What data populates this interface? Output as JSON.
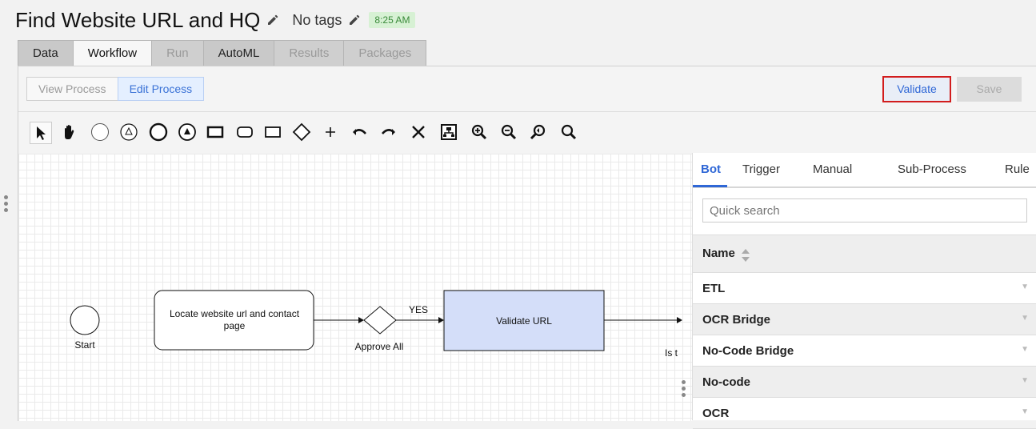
{
  "header": {
    "title": "Find Website URL and HQ",
    "tags": "No tags",
    "time": "8:25 AM"
  },
  "tabs": [
    {
      "label": "Data",
      "state": "normal"
    },
    {
      "label": "Workflow",
      "state": "active"
    },
    {
      "label": "Run",
      "state": "disabled"
    },
    {
      "label": "AutoML",
      "state": "normal"
    },
    {
      "label": "Results",
      "state": "disabled"
    },
    {
      "label": "Packages",
      "state": "disabled"
    }
  ],
  "process": {
    "view_label": "View Process",
    "edit_label": "Edit Process",
    "validate_label": "Validate",
    "save_label": "Save"
  },
  "toolbar_icons": [
    "pointer-icon",
    "hand-icon",
    "start-event-icon",
    "intermediate-event-icon",
    "end-event-icon",
    "signal-event-icon",
    "task-icon",
    "rounded-task-icon",
    "subprocess-icon",
    "gateway-icon",
    "add-icon",
    "undo-icon",
    "redo-icon",
    "delete-icon",
    "fit-icon",
    "zoom-in-icon",
    "zoom-out-icon",
    "zoom-reset-icon",
    "search-icon"
  ],
  "diagram": {
    "start_label": "Start",
    "task1_label_line1": "Locate website url and contact",
    "task1_label_line2": "page",
    "gateway_label": "Approve All",
    "flow_label": "YES",
    "task2_label": "Validate URL",
    "cut_label": "Is t"
  },
  "panel": {
    "tabs": [
      "Bot",
      "Trigger",
      "Manual",
      "Sub-Process",
      "Rule"
    ],
    "search_placeholder": "Quick search",
    "column_header": "Name",
    "rows": [
      "ETL",
      "OCR Bridge",
      "No-Code Bridge",
      "No-code",
      "OCR"
    ]
  },
  "colors": {
    "accent": "#2f67d6",
    "validate_border": "#d21d1d",
    "task_fill": "#d4def9"
  }
}
